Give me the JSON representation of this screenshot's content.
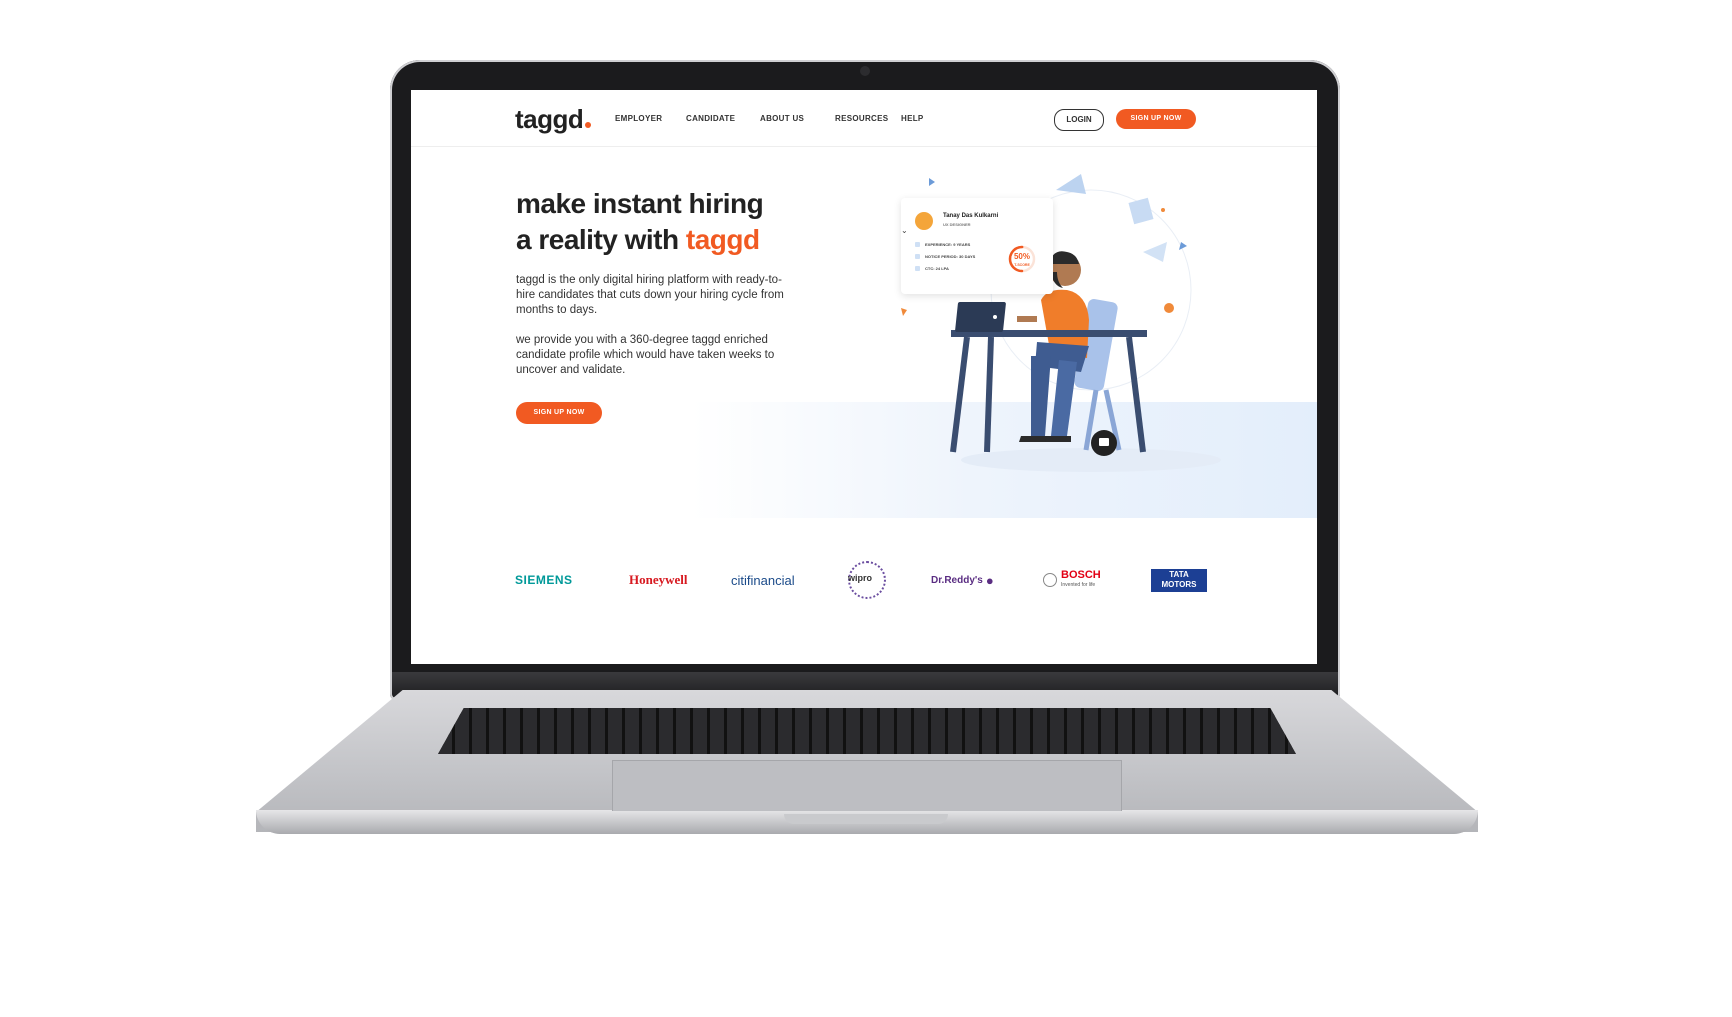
{
  "nav": {
    "logo": "taggd",
    "items": [
      "EMPLOYER",
      "CANDIDATE",
      "ABOUT US",
      "RESOURCES",
      "HELP"
    ],
    "login": "LOGIN",
    "signup": "SIGN UP NOW"
  },
  "hero": {
    "title_line1": "make instant hiring",
    "title_line2": "a reality with",
    "title_accent": "taggd",
    "para1": "taggd is the only digital hiring platform with ready-to-hire candidates that cuts down your hiring cycle from months to days.",
    "para2": "we provide you with a 360-degree taggd enriched candidate profile which would have taken weeks to uncover and validate.",
    "cta": "SIGN UP NOW"
  },
  "profile_card": {
    "name": "Tanay Das Kulkarni",
    "role": "UX DESIGNER",
    "rows": [
      "EXPERIENCE: 9 YEARS",
      "NOTICE PERIOD: 30 DAYS",
      "CTC: 24 LPA"
    ],
    "score": "50%",
    "score_label": "T-SCORE",
    "score_fraction": 0.5
  },
  "clients": [
    "SIEMENS",
    "Honeywell",
    "citifinancial",
    "wipro",
    "Dr.Reddy's",
    "BOSCH",
    "TATA MOTORS"
  ],
  "clients_sub": {
    "bosch": "Invented for life"
  },
  "colors": {
    "accent": "#f15a22",
    "siemens": "#009999",
    "honeywell": "#d71920",
    "citi": "#1b4b8a",
    "tata": "#1c3f94",
    "bosch": "#e20015",
    "drreddys": "#5a2d82"
  }
}
